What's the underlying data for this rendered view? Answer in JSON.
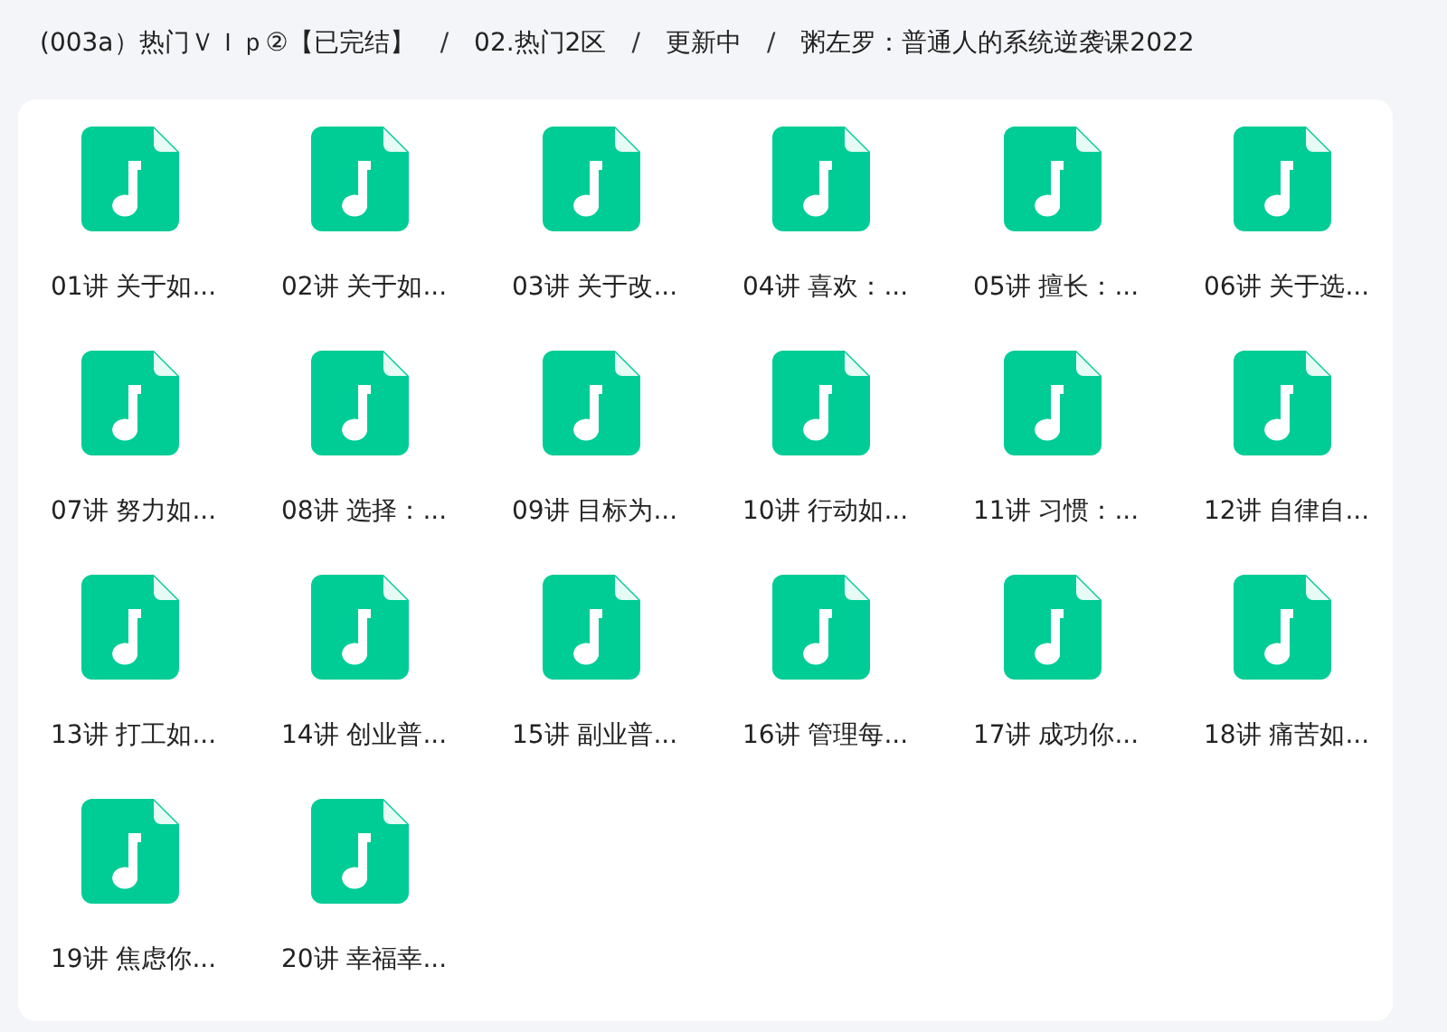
{
  "breadcrumb": {
    "separator": "/",
    "items": [
      "(003a）热门ＶＩｐ②【已完结】",
      "02.热门2区",
      "更新中",
      "粥左罗：普通人的系统逆袭课2022"
    ]
  },
  "files": [
    {
      "kind": "audio",
      "name": "01讲 关于如..."
    },
    {
      "kind": "audio",
      "name": "02讲 关于如..."
    },
    {
      "kind": "audio",
      "name": "03讲 关于改..."
    },
    {
      "kind": "audio",
      "name": "04讲 喜欢：..."
    },
    {
      "kind": "audio",
      "name": "05讲 擅长：..."
    },
    {
      "kind": "audio",
      "name": "06讲 关于选..."
    },
    {
      "kind": "audio",
      "name": "07讲 努力如..."
    },
    {
      "kind": "audio",
      "name": "08讲 选择：..."
    },
    {
      "kind": "audio",
      "name": "09讲 目标为..."
    },
    {
      "kind": "audio",
      "name": "10讲 行动如..."
    },
    {
      "kind": "audio",
      "name": "11讲 习惯：..."
    },
    {
      "kind": "audio",
      "name": "12讲 自律自..."
    },
    {
      "kind": "audio",
      "name": "13讲 打工如..."
    },
    {
      "kind": "audio",
      "name": "14讲 创业普..."
    },
    {
      "kind": "audio",
      "name": "15讲 副业普..."
    },
    {
      "kind": "audio",
      "name": "16讲 管理每..."
    },
    {
      "kind": "audio",
      "name": "17讲 成功你..."
    },
    {
      "kind": "audio",
      "name": "18讲 痛苦如..."
    },
    {
      "kind": "audio",
      "name": "19讲 焦虑你..."
    },
    {
      "kind": "audio",
      "name": "20讲 幸福幸..."
    }
  ]
}
